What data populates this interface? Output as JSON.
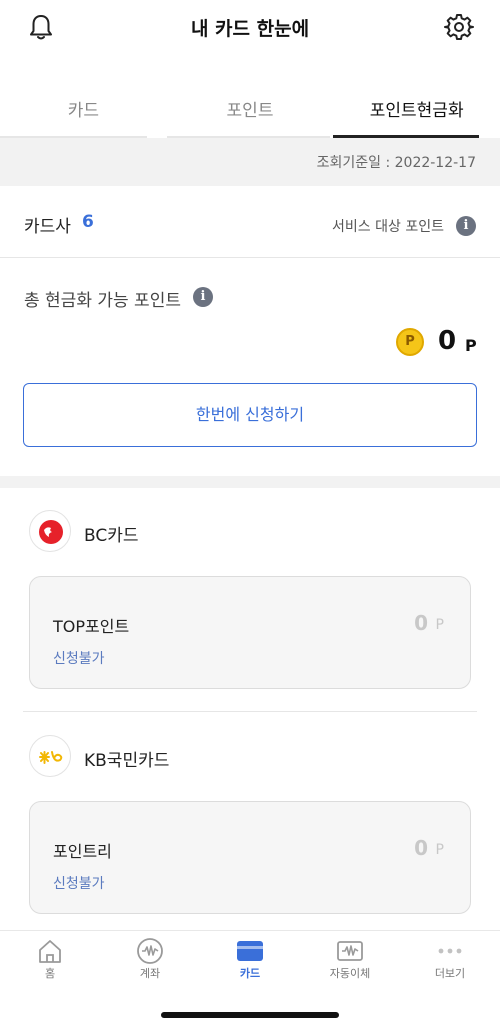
{
  "header": {
    "title": "내 카드 한눈에",
    "left_icon": "bell-icon",
    "right_icon": "gear-icon"
  },
  "tabs": [
    {
      "label": "카드",
      "active": false
    },
    {
      "label": "포인트",
      "active": false
    },
    {
      "label": "포인트현금화",
      "active": true
    }
  ],
  "inquiry_date": "조회기준일 : 2022-12-17",
  "card_companies": {
    "label": "카드사",
    "count": "6",
    "service_points_label": "서비스 대상 포인트"
  },
  "total": {
    "label": "총 현금화 가능 포인트",
    "coin_symbol": "P",
    "points": "0",
    "unit": "P",
    "apply_button": "한번에 신청하기"
  },
  "companies": [
    {
      "name": "BC카드",
      "logo_icon": "bc-card-logo-icon",
      "point_name": "TOP포인트",
      "point_value": "0",
      "point_unit": "P",
      "status": "신청불가"
    },
    {
      "name": "KB국민카드",
      "logo_icon": "kb-card-logo-icon",
      "point_name": "포인트리",
      "point_value": "0",
      "point_unit": "P",
      "status": "신청불가"
    }
  ],
  "bottom_nav": [
    {
      "label": "홈",
      "icon": "home-icon",
      "active": false
    },
    {
      "label": "계좌",
      "icon": "account-icon",
      "active": false
    },
    {
      "label": "카드",
      "icon": "card-icon",
      "active": true
    },
    {
      "label": "자동이체",
      "icon": "auto-transfer-icon",
      "active": false
    },
    {
      "label": "더보기",
      "icon": "more-icon",
      "active": false
    }
  ],
  "colors": {
    "accent": "#3a6fd9",
    "coin": "#f5c518",
    "bc_red": "#e6212a",
    "kb_yellow": "#f2b705"
  }
}
